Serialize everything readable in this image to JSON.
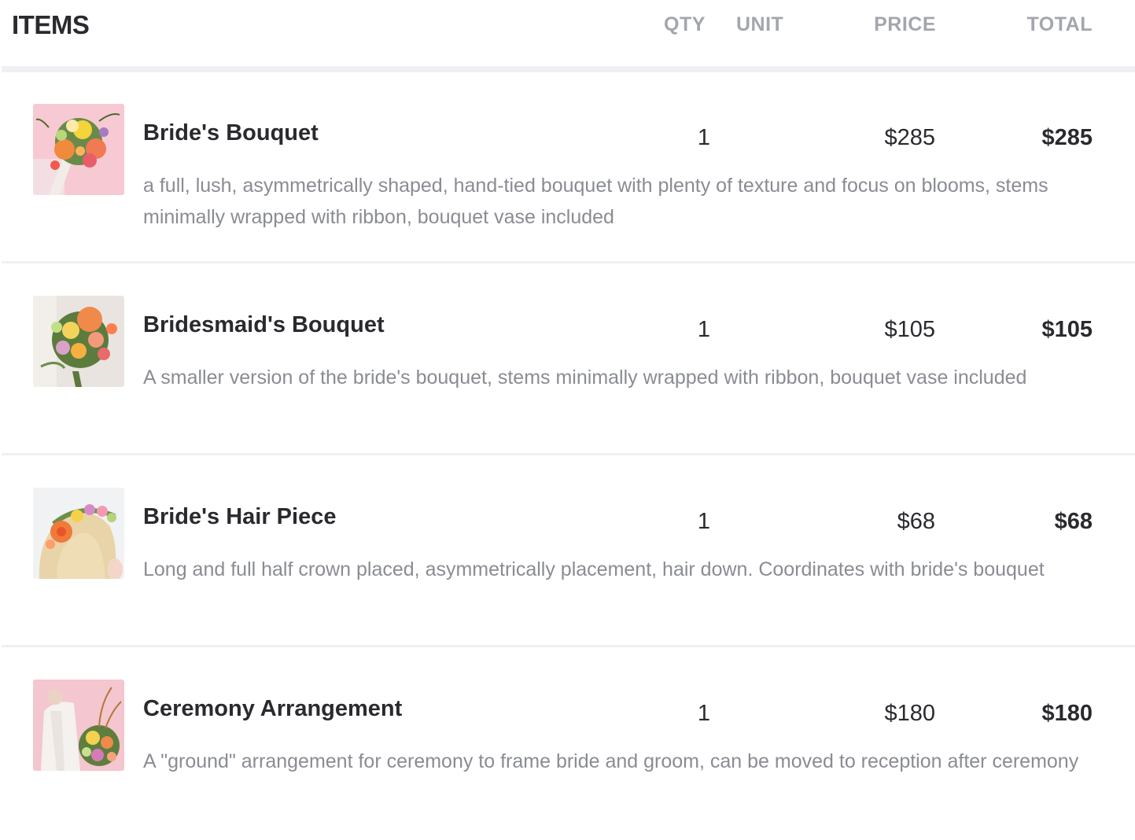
{
  "header": {
    "title": "ITEMS",
    "columns": {
      "qty": "QTY",
      "unit": "UNIT",
      "price": "PRICE",
      "total": "TOTAL"
    }
  },
  "items": [
    {
      "name": "Bride's Bouquet",
      "description": "a full, lush, asymmetrically shaped, hand-tied bouquet with plenty of texture and focus on blooms, stems minimally wrapped with ribbon, bouquet vase included",
      "qty": "1",
      "unit": "",
      "price": "$285",
      "total": "$285",
      "thumbnail": "bouquet-photo"
    },
    {
      "name": "Bridesmaid's Bouquet",
      "description": "A smaller version of the bride's bouquet, stems minimally wrapped with ribbon, bouquet vase included",
      "qty": "1",
      "unit": "",
      "price": "$105",
      "total": "$105",
      "thumbnail": "bouquet-photo"
    },
    {
      "name": "Bride's Hair Piece",
      "description": "Long and full half crown placed, asymmetrically placement, hair down.  Coordinates with bride's bouquet",
      "qty": "1",
      "unit": "",
      "price": "$68",
      "total": "$68",
      "thumbnail": "hair-piece-photo"
    },
    {
      "name": "Ceremony Arrangement",
      "description": "A \"ground\" arrangement for ceremony to frame bride and groom, can be moved to reception after ceremony",
      "qty": "1",
      "unit": "",
      "price": "$180",
      "total": "$180",
      "thumbnail": "arrangement-photo"
    }
  ],
  "colors": {
    "text_primary": "#2a2a2e",
    "text_muted": "#8a8c93",
    "header_muted": "#a3a6ad",
    "divider": "#eef0f3"
  }
}
